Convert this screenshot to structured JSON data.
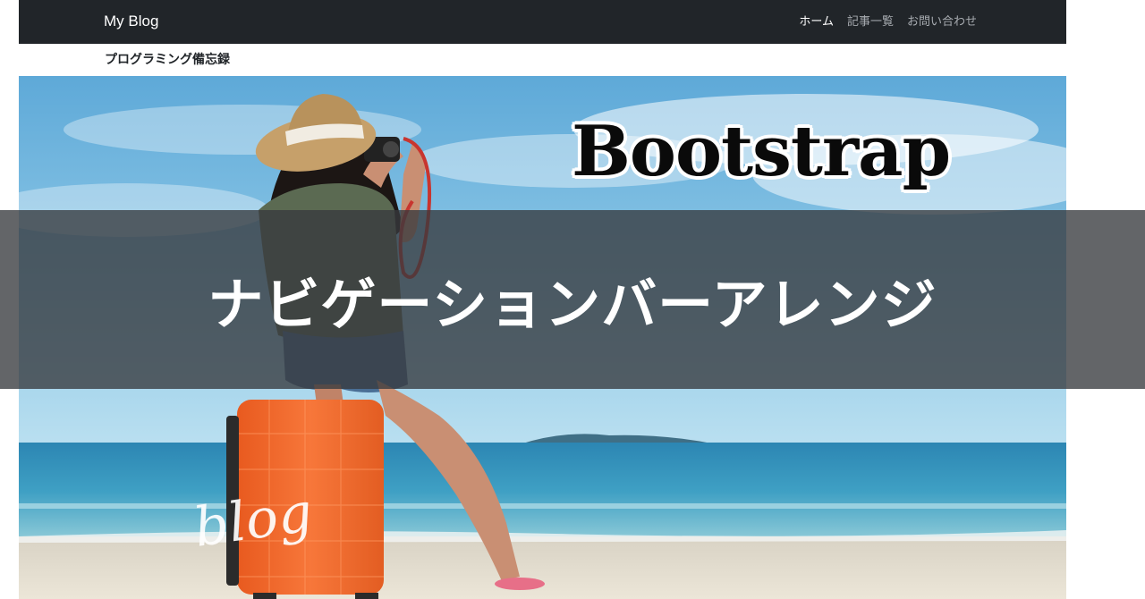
{
  "navbar": {
    "brand": "My Blog",
    "links": [
      {
        "label": "ホーム",
        "active": true
      },
      {
        "label": "記事一覧",
        "active": false
      },
      {
        "label": "お問い合わせ",
        "active": false
      }
    ]
  },
  "subtitle": "プログラミング備忘録",
  "hero": {
    "title": "Bootstrap",
    "banner_text": "ナビゲーションバーアレンジ",
    "script_text": "blog"
  },
  "colors": {
    "navbar_bg": "#212529",
    "banner_overlay": "rgba(55,58,62,0.78)",
    "sky": "#6ab4dc",
    "sea": "#2f8bb4",
    "suitcase": "#f36b2b"
  }
}
